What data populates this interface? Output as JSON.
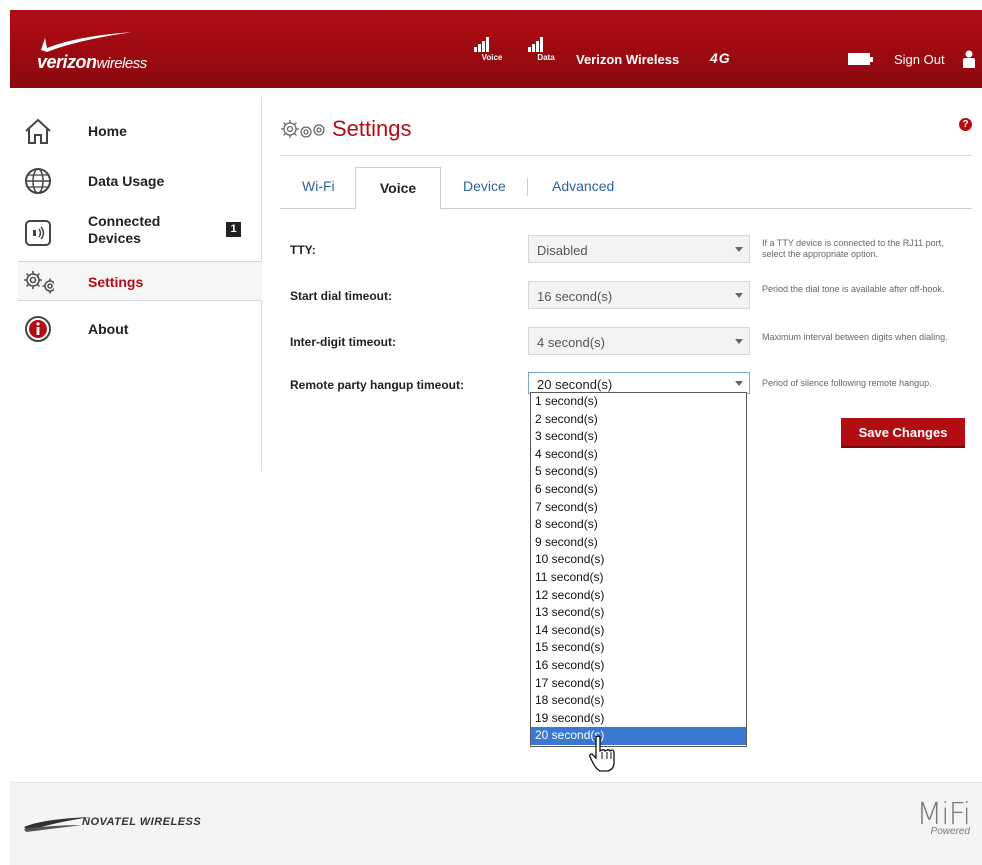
{
  "header": {
    "brand_main": "verizon",
    "brand_sub": "wireless",
    "signal_voice_label": "Voice",
    "signal_data_label": "Data",
    "network_name": "Verizon Wireless",
    "network_type": "4G",
    "signout_label": "Sign Out"
  },
  "sidebar": {
    "items": [
      {
        "label": "Home"
      },
      {
        "label": "Data Usage"
      },
      {
        "label": "Connected Devices",
        "badge": "1"
      },
      {
        "label": "Settings"
      },
      {
        "label": "About"
      }
    ]
  },
  "page": {
    "title": "Settings",
    "help": "?"
  },
  "tabs": [
    {
      "label": "Wi-Fi"
    },
    {
      "label": "Voice"
    },
    {
      "label": "Device"
    },
    {
      "label": "Advanced"
    }
  ],
  "form": {
    "tty": {
      "label": "TTY:",
      "value": "Disabled",
      "hint": "If a TTY device is connected to the RJ11 port, select the appropriate option."
    },
    "start_dial": {
      "label": "Start dial timeout:",
      "value": "16 second(s)",
      "hint": "Period the dial tone is available after off-hook."
    },
    "inter_digit": {
      "label": "Inter-digit timeout:",
      "value": "4 second(s)",
      "hint": "Maximum interval between digits when dialing."
    },
    "remote_hangup": {
      "label": "Remote party hangup timeout:",
      "value": "20 second(s)",
      "hint": "Period of silence following remote hangup."
    },
    "save_label": "Save Changes"
  },
  "dropdown": {
    "options": [
      "1 second(s)",
      "2 second(s)",
      "3 second(s)",
      "4 second(s)",
      "5 second(s)",
      "6 second(s)",
      "7 second(s)",
      "8 second(s)",
      "9 second(s)",
      "10 second(s)",
      "11 second(s)",
      "12 second(s)",
      "13 second(s)",
      "14 second(s)",
      "15 second(s)",
      "16 second(s)",
      "17 second(s)",
      "18 second(s)",
      "19 second(s)",
      "20 second(s)"
    ],
    "selected_index": 19
  },
  "footer": {
    "vendor": "NOVATEL WIRELESS",
    "product": "MiFi",
    "product_sub": "Powered"
  },
  "colors": {
    "brand_red": "#b30d14",
    "link_blue": "#2d63a8",
    "select_highlight": "#3b78d4"
  }
}
